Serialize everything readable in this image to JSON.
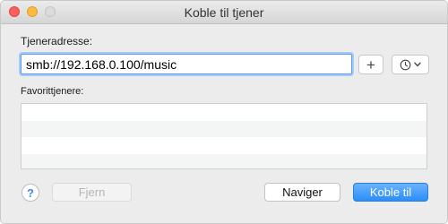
{
  "window": {
    "title": "Koble til tjener"
  },
  "form": {
    "server_address_label": "Tjeneradresse:",
    "server_address_value": "smb://192.168.0.100/music",
    "add_button_label": "+",
    "favorites_label": "Favorittjenere:",
    "favorites": []
  },
  "buttons": {
    "help": "?",
    "remove": "Fjern",
    "browse": "Naviger",
    "connect": "Koble til"
  },
  "icons": {
    "recent_servers": "clock-icon",
    "dropdown": "chevron-down-icon"
  },
  "colors": {
    "accent": "#2a8ef8",
    "focus_ring": "#5c9cf2",
    "close": "#fc605c",
    "minimize": "#fdbc40"
  }
}
